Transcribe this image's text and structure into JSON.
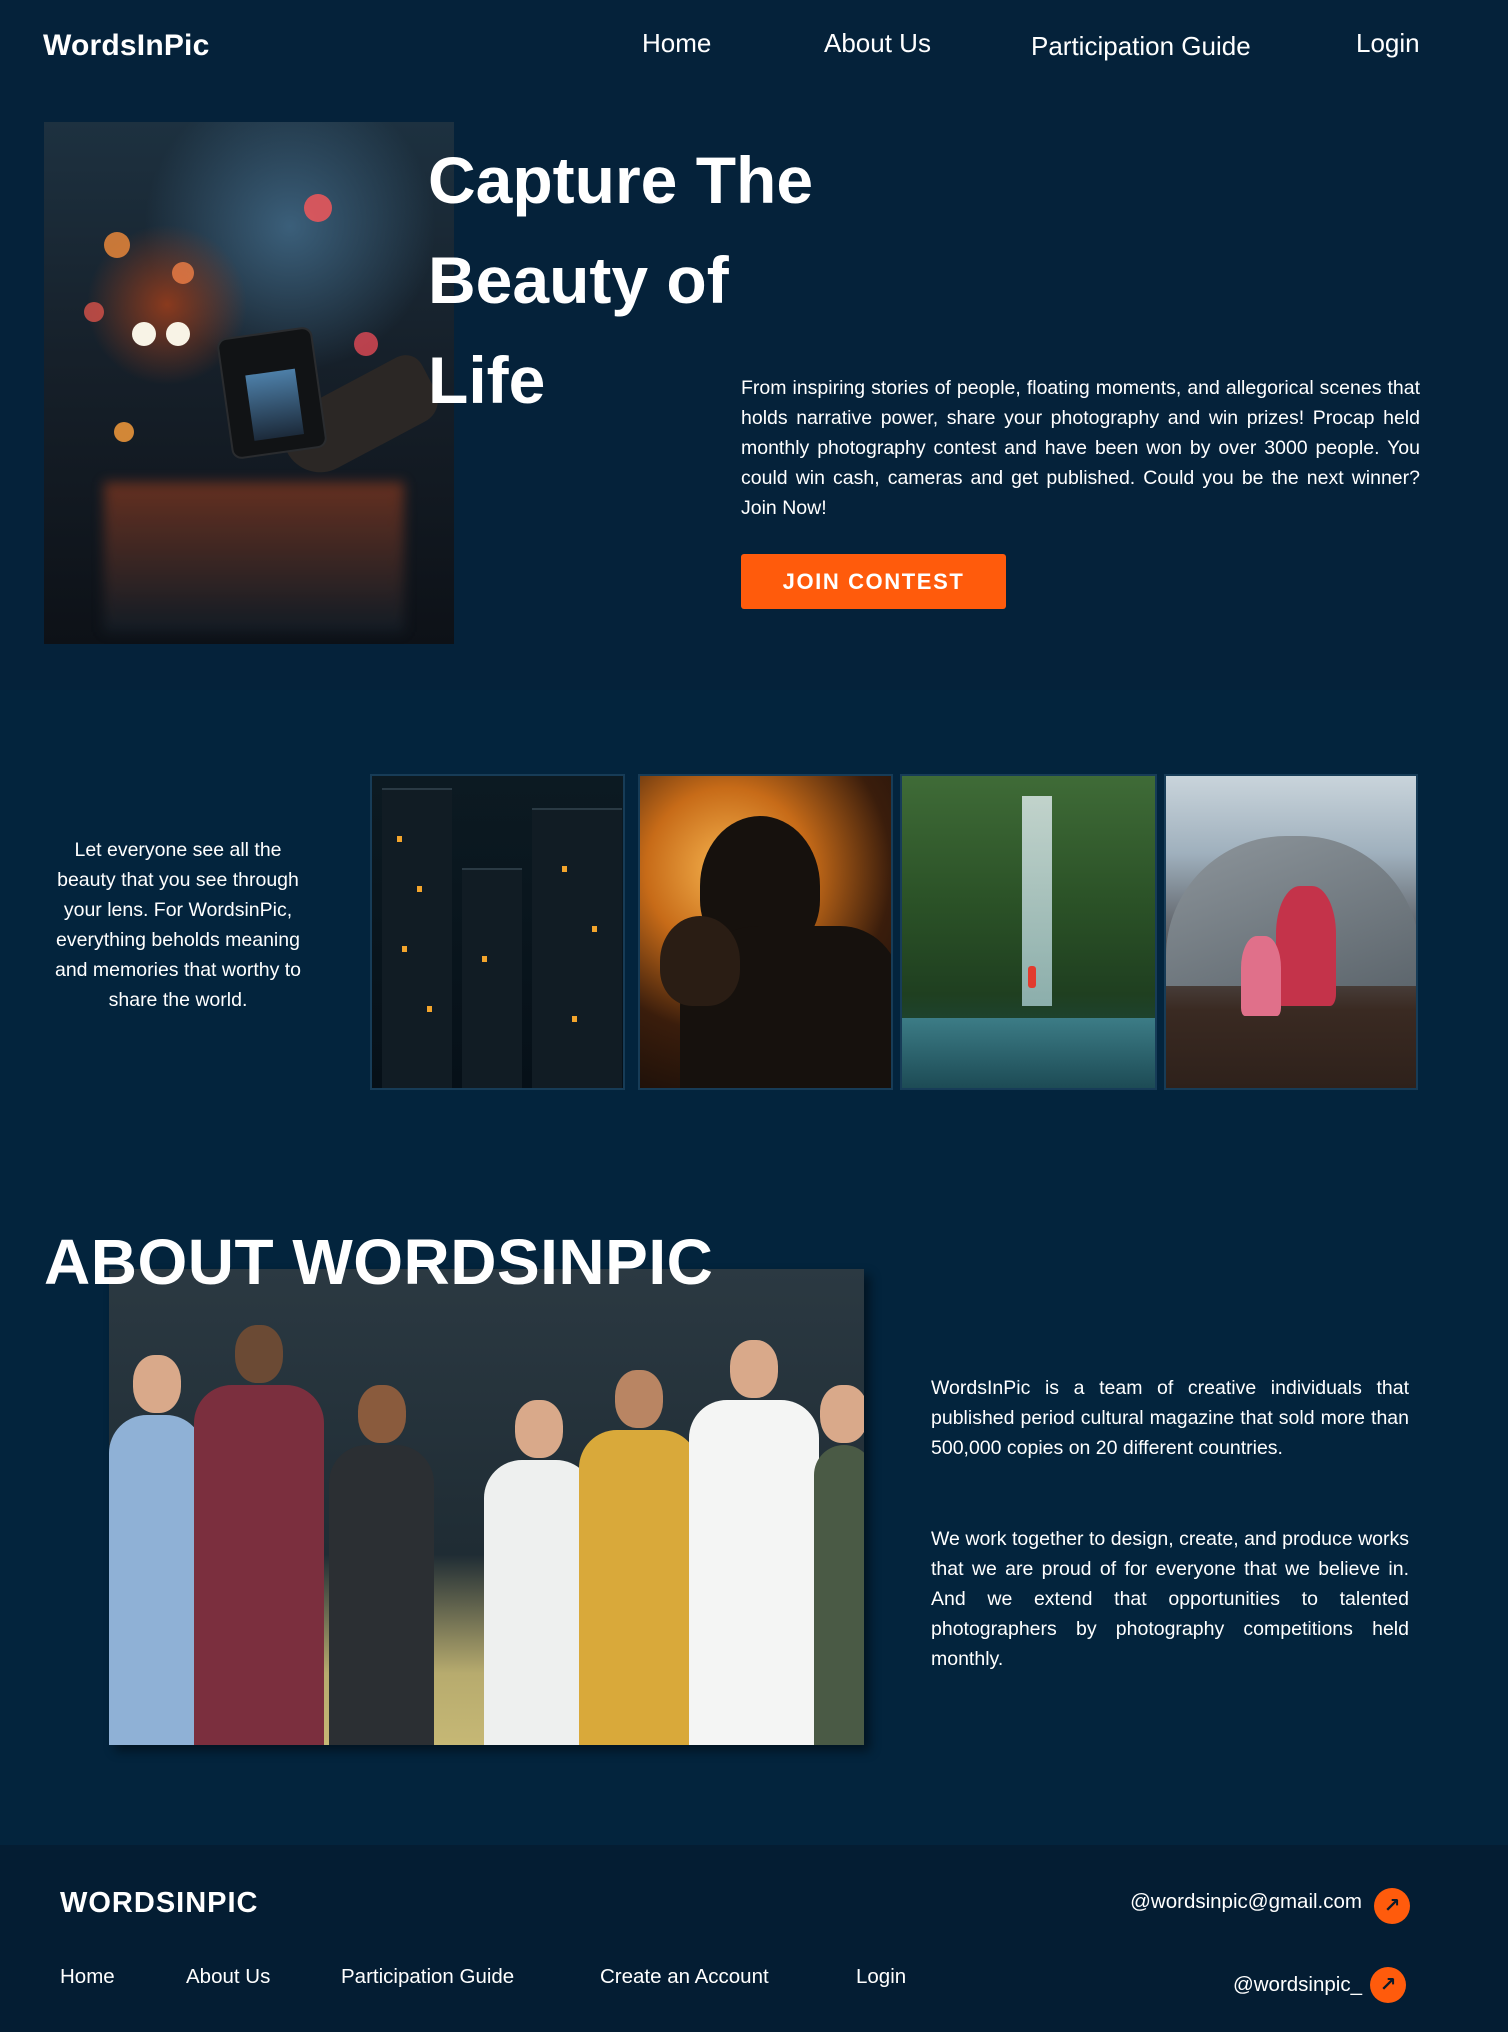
{
  "header": {
    "logo": "WordsInPic",
    "nav": {
      "home": "Home",
      "about": "About Us",
      "guide": "Participation Guide",
      "login": "Login"
    }
  },
  "hero": {
    "title_line1": "Capture The",
    "title_line2": "Beauty of",
    "title_line3": "Life",
    "description": "From inspiring stories of people, floating moments, and allegorical scenes that holds narrative power, share your photography and win prizes! Procap held monthly photography contest and have been won by over 3000 people. You could win cash, cameras and get published. Could you be the next winner? Join Now!",
    "cta_label": "JOIN CONTEST"
  },
  "gallery": {
    "text": "Let everyone see all the beauty that you see through your lens. For WordsinPic, everything beholds meaning and memories that worthy to share the world."
  },
  "about": {
    "title": "ABOUT WORDSINPIC",
    "paragraph1": "WordsInPic is a team of creative individuals that published  period cultural magazine that sold more than 500,000 copies on 20 different countries.",
    "paragraph2": "We work together to design, create, and produce works that we are proud of for everyone that we believe in. And we extend that opportunities to talented photographers by photography competitions held monthly."
  },
  "footer": {
    "logo": "WORDSINPIC",
    "links": {
      "home": "Home",
      "about": "About Us",
      "guide": "Participation Guide",
      "create": "Create an Account",
      "login": "Login"
    },
    "email": "@wordsinpic@gmail.com",
    "social": "@wordsinpic_",
    "arrow_icon": "arrow-up-right-icon"
  },
  "colors": {
    "background": "#03243d",
    "hero_background": "#05223a",
    "footer_background": "#041d33",
    "accent": "#ff5b0c",
    "text": "#ffffff"
  }
}
